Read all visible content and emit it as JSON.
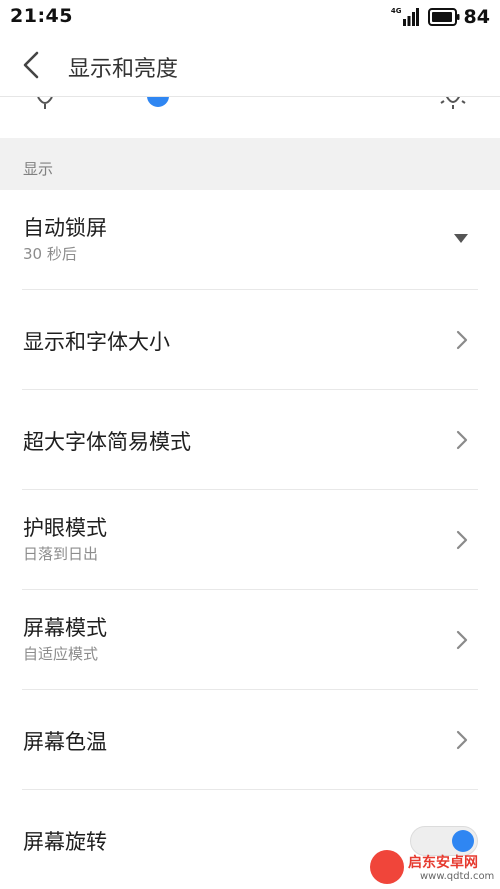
{
  "status_bar": {
    "time": "21:45",
    "network": "4G",
    "battery": "84"
  },
  "header": {
    "title": "显示和亮度",
    "back_icon": "chevron-left-icon"
  },
  "brightness": {
    "level": 0.28,
    "accent": "#2f86f2"
  },
  "section": {
    "label": "显示"
  },
  "items": [
    {
      "title": "自动锁屏",
      "subtitle": "30 秒后",
      "control": "dropdown-caret-icon"
    },
    {
      "title": "显示和字体大小",
      "control": "chevron-right-icon"
    },
    {
      "title": "超大字体简易模式",
      "control": "chevron-right-icon"
    },
    {
      "title": "护眼模式",
      "subtitle": "日落到日出",
      "control": "chevron-right-icon"
    },
    {
      "title": "屏幕模式",
      "subtitle": "自适应模式",
      "control": "chevron-right-icon"
    },
    {
      "title": "屏幕色温",
      "control": "chevron-right-icon"
    },
    {
      "title": "屏幕旋转",
      "control": "toggle",
      "toggle_on": true
    }
  ],
  "watermark": {
    "name": "启东安卓网",
    "url": "www.qdtd.com"
  },
  "colors": {
    "accent": "#2f86f2",
    "section_bg": "#f1f1f1",
    "divider": "#e8e8e8"
  }
}
